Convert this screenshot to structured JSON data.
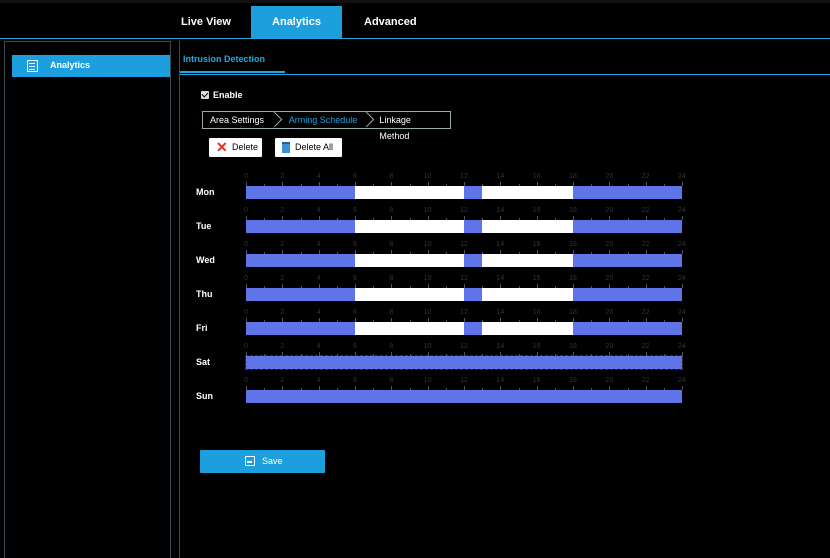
{
  "nav": {
    "tabs": [
      {
        "label": "Live View",
        "active": false
      },
      {
        "label": "Analytics",
        "active": true
      },
      {
        "label": "Advanced",
        "active": false
      }
    ]
  },
  "sidebar": {
    "items": [
      {
        "label": "Analytics",
        "icon": "calendar-icon",
        "active": true
      }
    ]
  },
  "main": {
    "subtab": "Intrusion Detection",
    "enable_label": "Enable",
    "enable_checked": true,
    "steps": [
      "Area Settings",
      "Arming Schedule",
      "Linkage Method"
    ],
    "active_step": 1,
    "buttons": {
      "delete": "Delete",
      "delete_all": "Delete All",
      "save": "Save"
    }
  },
  "schedule": {
    "hour_ticks": [
      "0",
      "2",
      "4",
      "6",
      "8",
      "10",
      "12",
      "14",
      "16",
      "18",
      "20",
      "22",
      "24"
    ],
    "days": [
      {
        "name": "Mon",
        "segments": [
          [
            0,
            6
          ],
          [
            12,
            13
          ],
          [
            18,
            24
          ]
        ],
        "selected": false
      },
      {
        "name": "Tue",
        "segments": [
          [
            0,
            6
          ],
          [
            12,
            13
          ],
          [
            18,
            24
          ]
        ],
        "selected": false
      },
      {
        "name": "Wed",
        "segments": [
          [
            0,
            6
          ],
          [
            12,
            13
          ],
          [
            18,
            24
          ]
        ],
        "selected": false
      },
      {
        "name": "Thu",
        "segments": [
          [
            0,
            6
          ],
          [
            12,
            13
          ],
          [
            18,
            24
          ]
        ],
        "selected": false
      },
      {
        "name": "Fri",
        "segments": [
          [
            0,
            6
          ],
          [
            12,
            13
          ],
          [
            18,
            24
          ]
        ],
        "selected": false
      },
      {
        "name": "Sat",
        "segments": [
          [
            0,
            24
          ]
        ],
        "selected": true
      },
      {
        "name": "Sun",
        "segments": [
          [
            0,
            24
          ]
        ],
        "selected": false
      }
    ],
    "colors": {
      "armed": "#5f74e6",
      "unarmed": "#ffffff"
    }
  },
  "colors": {
    "accent": "#1e9fdd",
    "background": "#000000"
  }
}
